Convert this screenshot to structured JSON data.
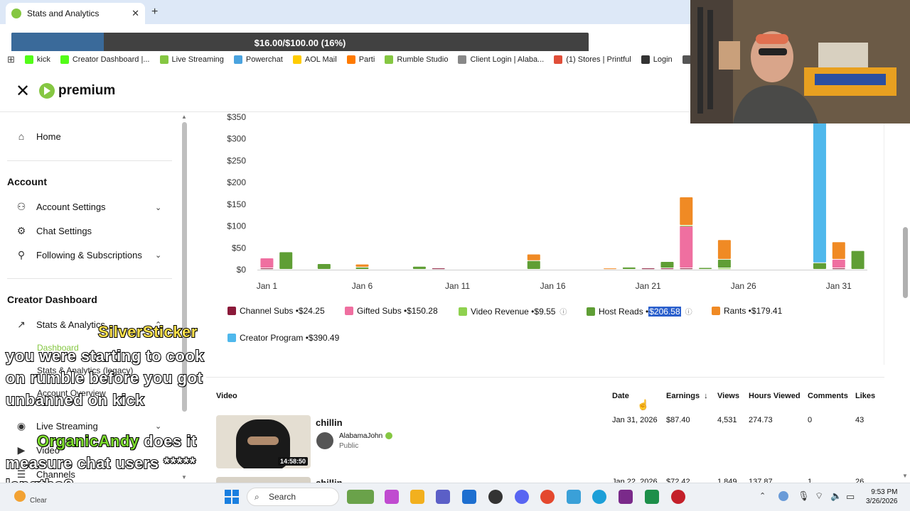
{
  "browser": {
    "tab_title": "Stats and Analytics",
    "new_tab_symbol": "+",
    "close_symbol": "✕",
    "goal_bar": {
      "text": "$16.00/$100.00 (16%)",
      "progress": 0.16
    },
    "bookmarks": [
      {
        "label": "kick",
        "color": "#53fc18"
      },
      {
        "label": "Creator Dashboard |...",
        "color": "#53fc18"
      },
      {
        "label": "Live Streaming",
        "color": "#85c742"
      },
      {
        "label": "Powerchat",
        "color": "#4aa3df"
      },
      {
        "label": "AOL Mail",
        "color": "#ffcc00"
      },
      {
        "label": "Parti",
        "color": "#ff7a00"
      },
      {
        "label": "Rumble Studio",
        "color": "#85c742"
      },
      {
        "label": "Client Login | Alaba...",
        "color": "#888888"
      },
      {
        "label": "(1) Stores | Printful",
        "color": "#e04e39"
      },
      {
        "label": "Login",
        "color": "#333333"
      },
      {
        "label": "ezgif.co",
        "color": "#555555"
      }
    ]
  },
  "header": {
    "logo_text": "premium",
    "close_symbol": "✕"
  },
  "sidebar": {
    "home": "Home",
    "account_heading": "Account",
    "account_items": [
      "Account Settings",
      "Chat Settings",
      "Following & Subscriptions"
    ],
    "creator_heading": "Creator Dashboard",
    "stats_label": "Stats & Analytics",
    "stats_sub": [
      "Dashboard",
      "Stats & Analytics (legacy)",
      "Account Overview"
    ],
    "live_label": "Live Streaming",
    "videos_label": "Video",
    "channels_label": "Channels"
  },
  "chart_data": {
    "type": "bar",
    "stacked": true,
    "y_ticks": [
      "$350",
      "$300",
      "$250",
      "$200",
      "$150",
      "$100",
      "$50",
      "$0"
    ],
    "ylim": [
      0,
      350
    ],
    "x_ticks": [
      "Jan 1",
      "Jan 6",
      "Jan 11",
      "Jan 16",
      "Jan 21",
      "Jan 26",
      "Jan 31"
    ],
    "categories": [
      "Jan 1",
      "Jan 2",
      "Jan 3",
      "Jan 4",
      "Jan 5",
      "Jan 6",
      "Jan 7",
      "Jan 8",
      "Jan 9",
      "Jan 10",
      "Jan 11",
      "Jan 12",
      "Jan 13",
      "Jan 14",
      "Jan 15",
      "Jan 16",
      "Jan 17",
      "Jan 18",
      "Jan 19",
      "Jan 20",
      "Jan 21",
      "Jan 22",
      "Jan 23",
      "Jan 24",
      "Jan 25",
      "Jan 26",
      "Jan 27",
      "Jan 28",
      "Jan 29",
      "Jan 30",
      "Jan 31",
      "Feb 1"
    ],
    "series": [
      {
        "name": "Channel Subs",
        "color": "#8b1a3a",
        "values": [
          3,
          0,
          0,
          0,
          0,
          0,
          0,
          0,
          0,
          3,
          0,
          0,
          0,
          0,
          0,
          0,
          0,
          0,
          0,
          0,
          3,
          3,
          3,
          0,
          0,
          0,
          0,
          0,
          0,
          0,
          3,
          0
        ]
      },
      {
        "name": "Gifted Subs",
        "color": "#ef6fa0",
        "values": [
          23,
          0,
          0,
          0,
          0,
          0,
          0,
          0,
          0,
          0,
          0,
          0,
          0,
          0,
          0,
          0,
          0,
          0,
          0,
          0,
          0,
          0,
          97,
          0,
          0,
          0,
          0,
          0,
          0,
          0,
          20,
          0
        ]
      },
      {
        "name": "Video Revenue",
        "color": "#8fd14f",
        "values": [
          0,
          0,
          0,
          0,
          0,
          0,
          0,
          0,
          0,
          0,
          0,
          0,
          0,
          0,
          0,
          0,
          0,
          0,
          0,
          0,
          0,
          0,
          1,
          0,
          3,
          0,
          0,
          0,
          0,
          0,
          0,
          0
        ]
      },
      {
        "name": "Host Reads",
        "color": "#5f9e35",
        "values": [
          0,
          40,
          0,
          13,
          0,
          5,
          0,
          0,
          7,
          0,
          0,
          0,
          0,
          0,
          20,
          0,
          0,
          0,
          0,
          5,
          0,
          15,
          0,
          4,
          20,
          0,
          0,
          0,
          0,
          15,
          0,
          43
        ]
      },
      {
        "name": "Rants",
        "color": "#f08a24",
        "values": [
          0,
          0,
          0,
          0,
          0,
          7,
          0,
          0,
          0,
          0,
          0,
          0,
          0,
          0,
          15,
          0,
          0,
          0,
          3,
          0,
          0,
          0,
          65,
          0,
          45,
          0,
          0,
          0,
          0,
          0,
          40,
          0
        ]
      },
      {
        "name": "Creator Program",
        "color": "#4fb8ec",
        "values": [
          0,
          0,
          0,
          0,
          0,
          0,
          0,
          0,
          0,
          0,
          0,
          0,
          0,
          0,
          0,
          0,
          0,
          0,
          0,
          0,
          0,
          0,
          0,
          0,
          0,
          0,
          0,
          0,
          0,
          340,
          0,
          0
        ]
      }
    ],
    "legend": [
      {
        "name": "Channel Subs",
        "value": "$24.25",
        "color": "#8b1a3a",
        "info": false
      },
      {
        "name": "Gifted Subs",
        "value": "$150.28",
        "color": "#ef6fa0",
        "info": false
      },
      {
        "name": "Video Revenue",
        "value": "$9.55",
        "color": "#8fd14f",
        "info": true
      },
      {
        "name": "Host Reads",
        "value": "$206.58",
        "color": "#5f9e35",
        "info": true,
        "highlight": true
      },
      {
        "name": "Rants",
        "value": "$179.41",
        "color": "#f08a24",
        "info": false
      },
      {
        "name": "Creator Program",
        "value": "$390.49",
        "color": "#4fb8ec",
        "info": false
      }
    ],
    "legend_separator": " • "
  },
  "table": {
    "headers": {
      "video": "Video",
      "date": "Date",
      "earnings": "Earnings",
      "views": "Views",
      "hours": "Hours Viewed",
      "comments": "Comments",
      "likes": "Likes"
    },
    "sort_arrow": "↓",
    "rows": [
      {
        "title": "chillin",
        "channel": "AlabamaJohn",
        "visibility": "Public",
        "duration": "14:58:50",
        "date": "Jan 31, 2026",
        "earnings": "$87.40",
        "views": "4,531",
        "hours": "274.73",
        "comments": "0",
        "likes": "43"
      },
      {
        "title": "chillin",
        "channel": "",
        "visibility": "",
        "duration": "",
        "date": "Jan 22, 2026",
        "earnings": "$72.42",
        "views": "1,849",
        "hours": "137.87",
        "comments": "1",
        "likes": "26"
      }
    ]
  },
  "chat_overlay": [
    {
      "user": "SilverSticker",
      "message": "you were starting to cook on rumble before you got unbanned on kick"
    },
    {
      "user": "OrganicAndy",
      "message": "does it measure chat users ***** lengths?"
    }
  ],
  "taskbar": {
    "search_placeholder": "Search",
    "weather": "Clear",
    "time": "9:53 PM",
    "date": "3/26/2026"
  }
}
